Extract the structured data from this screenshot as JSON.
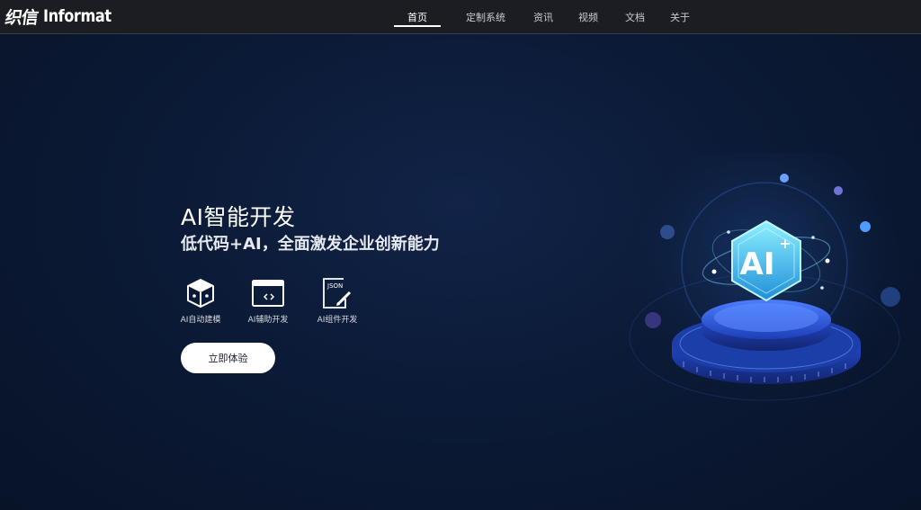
{
  "brand": {
    "logo_cn": "织信",
    "logo_en": "Informat"
  },
  "nav": {
    "items": [
      {
        "label": "首页",
        "active": true
      },
      {
        "label": "定制系统",
        "active": false
      },
      {
        "label": "资讯",
        "active": false
      },
      {
        "label": "视频",
        "active": false
      },
      {
        "label": "文档",
        "active": false
      },
      {
        "label": "关于",
        "active": false
      }
    ]
  },
  "hero": {
    "title": "AI智能开发",
    "subtitle": "低代码+AI，全面激发企业创新能力",
    "features": [
      {
        "label": "AI自动建模",
        "icon": "cube-icon"
      },
      {
        "label": "AI辅助开发",
        "icon": "code-window-icon"
      },
      {
        "label": "AI组件开发",
        "icon": "json-document-icon"
      }
    ],
    "cta_label": "立即体验",
    "illustration": {
      "badge_text": "AI",
      "badge_sup": "+"
    }
  },
  "colors": {
    "background": "#0b1a36",
    "navbar": "#1b1d22",
    "accent_blue": "#2f6df6",
    "badge_cyan": "#4fd3f2",
    "cta_bg": "#ffffff"
  }
}
